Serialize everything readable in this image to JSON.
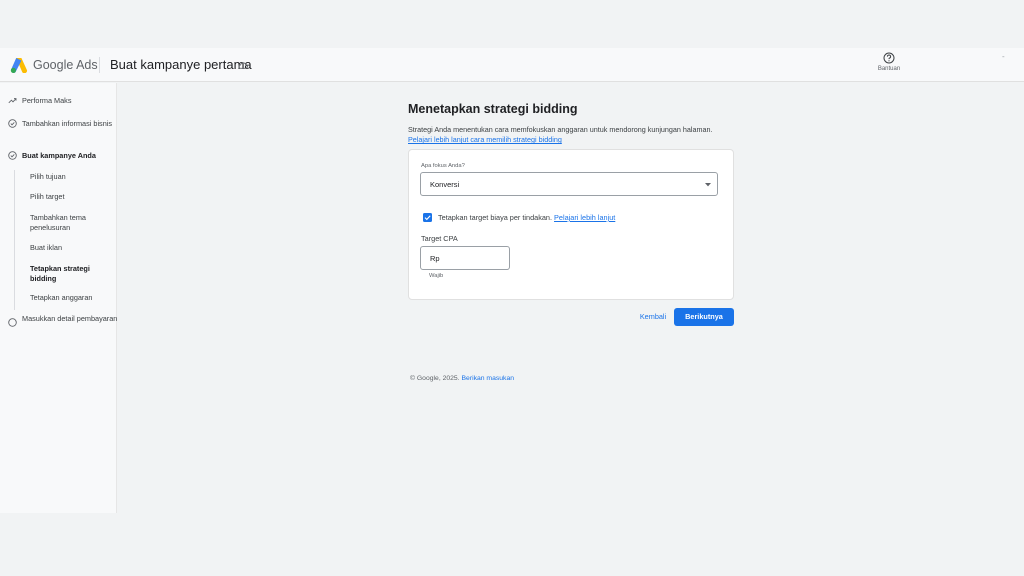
{
  "header": {
    "brand": "Google Ads",
    "campaign_title": "Buat kampanye pertama",
    "help_label": "Bantuan",
    "dash": "-"
  },
  "sidebar": {
    "items": [
      {
        "label": "Performa Maks"
      },
      {
        "label": "Tambahkan informasi bisnis"
      },
      {
        "label": "Buat kampanye Anda"
      },
      {
        "label": "Masukkan detail pembayaran"
      }
    ],
    "sub_items": [
      {
        "label": "Pilih tujuan"
      },
      {
        "label": "Pilih target"
      },
      {
        "label": "Tambahkan tema penelusuran"
      },
      {
        "label": "Buat iklan"
      },
      {
        "label": "Tetapkan strategi bidding"
      },
      {
        "label": "Tetapkan anggaran"
      }
    ]
  },
  "main": {
    "title": "Menetapkan strategi bidding",
    "description": "Strategi Anda menentukan cara memfokuskan anggaran untuk mendorong kunjungan halaman.",
    "learn_more_link": "Pelajari lebih lanjut cara memilih strategi bidding",
    "focus_label": "Apa fokus Anda?",
    "focus_value": "Konversi",
    "checkbox_label": "Tetapkan target biaya per tindakan.",
    "checkbox_link": "Pelajari lebih lanjut",
    "checkbox_checked": true,
    "cpa_label": "Target CPA",
    "cpa_prefix": "Rp",
    "required_label": "Wajib",
    "back_label": "Kembali",
    "next_label": "Berikutnya"
  },
  "footer": {
    "copyright": "© Google, 2025.",
    "feedback_link": "Berikan masukan"
  },
  "colors": {
    "accent": "#1a73e8",
    "background": "#f1f3f4",
    "card": "#ffffff"
  }
}
